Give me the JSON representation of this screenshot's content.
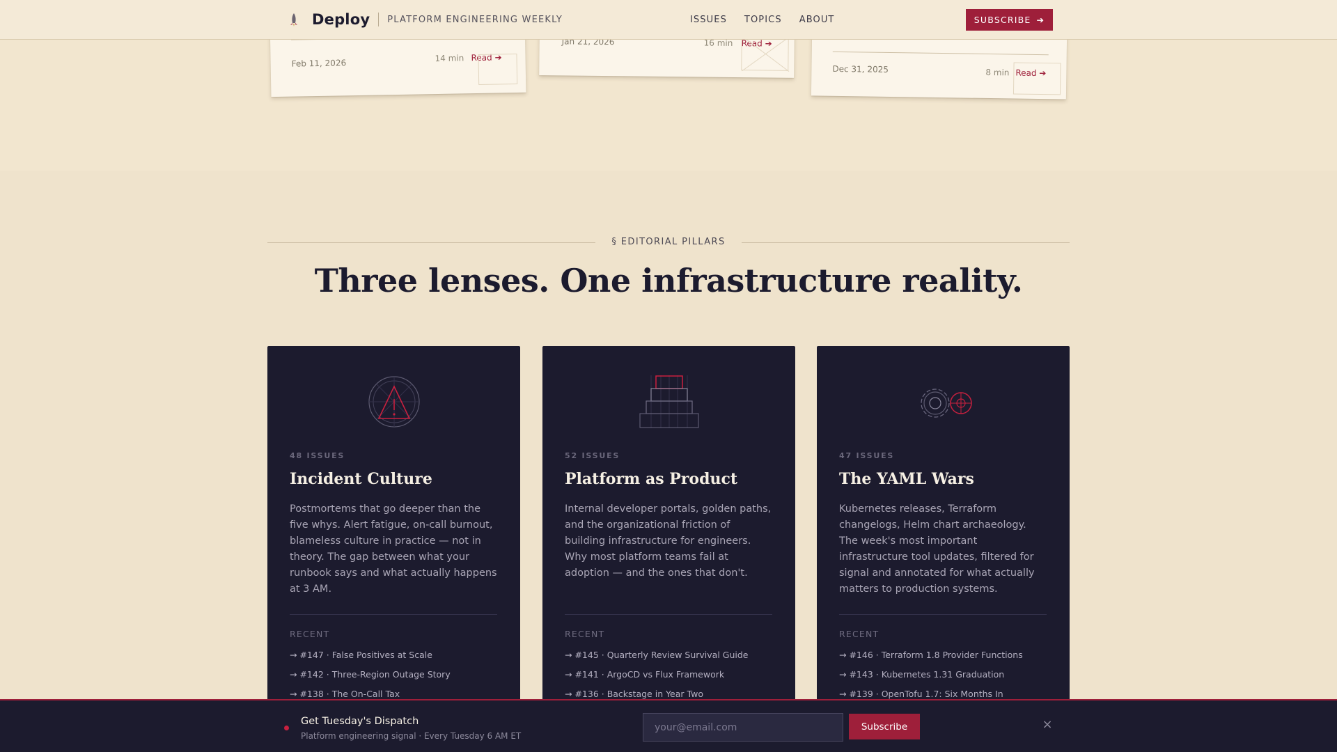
{
  "header": {
    "brand": "Deploy",
    "tagline": "PLATFORM ENGINEERING WEEKLY",
    "nav": [
      "ISSUES",
      "TOPICS",
      "ABOUT"
    ],
    "subscribe_label": "SUBSCRIBE"
  },
  "issue_cards": [
    {
      "date": "Feb 11, 2026",
      "minutes": "14 min",
      "read": "Read"
    },
    {
      "date": "Jan 21, 2026",
      "minutes": "16 min",
      "read": "Read"
    },
    {
      "date": "Dec 31, 2025",
      "minutes": "8 min",
      "read": "Read"
    }
  ],
  "pillars_section": {
    "eyebrow": "§ EDITORIAL PILLARS",
    "title": "Three lenses. One infrastructure reality.",
    "recent_label": "RECENT",
    "pillars": [
      {
        "count": "48 ISSUES",
        "title": "Incident Culture",
        "description": "Postmortems that go deeper than the five whys. Alert fatigue, on-call burnout, blameless culture in practice — not in theory. The gap between what your runbook says and what actually happens at 3 AM.",
        "recent": [
          "→ #147 · False Positives at Scale",
          "→ #142 · Three-Region Outage Story",
          "→ #138 · The On-Call Tax"
        ]
      },
      {
        "count": "52 ISSUES",
        "title": "Platform as Product",
        "description": "Internal developer portals, golden paths, and the organizational friction of building infrastructure for engineers. Why most platform teams fail at adoption — and the ones that don't.",
        "recent": [
          "→ #145 · Quarterly Review Survival Guide",
          "→ #141 · ArgoCD vs Flux Framework",
          "→ #136 · Backstage in Year Two"
        ]
      },
      {
        "count": "47 ISSUES",
        "title": "The YAML Wars",
        "description": "Kubernetes releases, Terraform changelogs, Helm chart archaeology. The week's most important infrastructure tool updates, filtered for signal and annotated for what actually matters to production systems.",
        "recent": [
          "→ #146 · Terraform 1.8 Provider Functions",
          "→ #143 · Kubernetes 1.31 Graduation",
          "→ #139 · OpenTofu 1.7: Six Months In"
        ]
      }
    ]
  },
  "dispatch": {
    "title": "Get Tuesday's Dispatch",
    "subtitle": "Platform engineering signal · Every Tuesday 6 AM ET",
    "email_placeholder": "your@email.com",
    "button": "Subscribe",
    "close": "×"
  },
  "colors": {
    "accent": "#9e1f3a",
    "navy": "#1c1b2e",
    "paper": "#efe3cc"
  }
}
